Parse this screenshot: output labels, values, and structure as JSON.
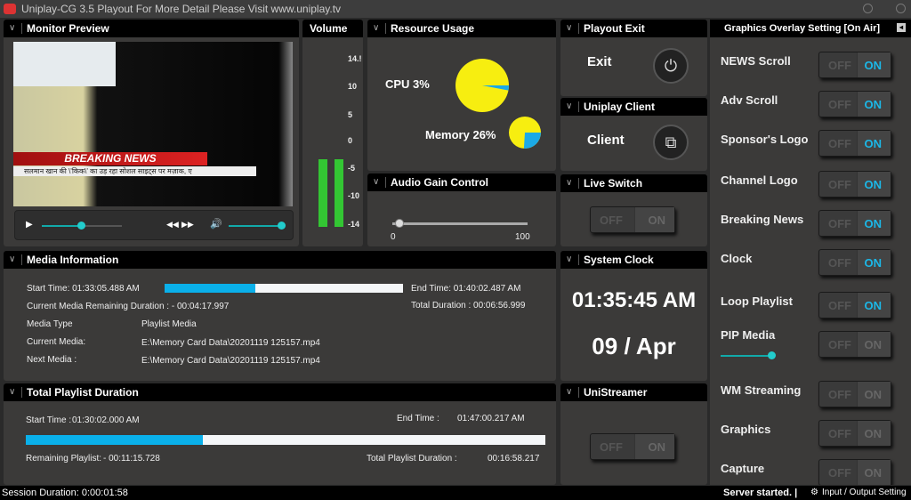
{
  "title": "Uniplay-CG 3.5 Playout For More Detail Please Visit www.uniplay.tv",
  "monitor": {
    "title": "Monitor Preview",
    "breaking": "BREAKING NEWS",
    "ticker": "सलमान खान की \\'किक\\' का उड़ रहा सोशल साइट्स पर मज़ाक, ए",
    "seek_progress": 0.49,
    "volume_level": 1.0,
    "icons": [
      "play-icon",
      "rewind-icon",
      "fast-forward-icon",
      "speaker-icon"
    ]
  },
  "volume": {
    "title": "Volume",
    "ticks": [
      "14.!",
      "10",
      "5",
      "0",
      "-5",
      "-10",
      "-14"
    ],
    "left_level": 0.35,
    "right_level": 0.35
  },
  "resource": {
    "title": "Resource Usage",
    "cpu": "CPU 3%",
    "memory": "Memory 26%",
    "cpu_pct": 3,
    "memory_pct": 26,
    "color_main": "#f7ee10",
    "color_used": "#1ba9e6"
  },
  "audio": {
    "title": "Audio Gain Control",
    "min": "0",
    "max": "100",
    "value": 5
  },
  "playout": {
    "title": "Playout Exit",
    "label": "Exit"
  },
  "client": {
    "title": "Uniplay Client",
    "label": "Client"
  },
  "live": {
    "title": "Live Switch",
    "off": "OFF",
    "on": "ON"
  },
  "media": {
    "title": "Media Information",
    "start": "Start Time:  01:33:05.488 AM",
    "end": "End Time:  01:40:02.487 AM",
    "remaining": "Current Media Remaining Duration : - 00:04:17.997",
    "total": "Total Duration :  00:06:56.999",
    "progress": 0.38,
    "rows": [
      {
        "k": "Media Type",
        "v": "Playlist Media"
      },
      {
        "k": "Current Media:",
        "v": "E:\\Memory Card Data\\20201119 125157.mp4"
      },
      {
        "k": "Next Media :",
        "v": "E:\\Memory Card Data\\20201119 125157.mp4"
      }
    ]
  },
  "clock": {
    "title": "System Clock",
    "time": "01:35:45 AM",
    "date": "09 / Apr"
  },
  "playlist": {
    "title": "Total Playlist Duration",
    "start_k": "Start Time :",
    "start_v": "01:30:02.000 AM",
    "end_k": "End Time :",
    "end_v": "01:47:00.217 AM",
    "progress": 0.34,
    "remaining_k": "Remaining Playlist:",
    "remaining_v": "- 00:11:15.728",
    "total_k": "Total Playlist Duration :",
    "total_v": "00:16:58.217"
  },
  "streamer": {
    "title": "UniStreamer",
    "off": "OFF",
    "on": "ON"
  },
  "overlay": {
    "title": "Graphics Overlay Setting [On Air]",
    "off": "OFF",
    "on": "ON",
    "pip_level": 1.0,
    "items": [
      {
        "label": "NEWS Scroll",
        "on": true
      },
      {
        "label": "Adv Scroll",
        "on": true
      },
      {
        "label": "Sponsor's Logo",
        "on": true
      },
      {
        "label": "Channel Logo",
        "on": true
      },
      {
        "label": "Breaking News",
        "on": true
      },
      {
        "label": "Clock",
        "on": true
      },
      {
        "label": "Loop Playlist",
        "on": true
      },
      {
        "label": "PIP Media",
        "on": false
      },
      {
        "label": "WM Streaming",
        "on": false
      },
      {
        "label": "Graphics",
        "on": false
      },
      {
        "label": "Capture",
        "on": false
      }
    ]
  },
  "status": {
    "session": "Session Duration: 0:00:01:58",
    "server": "Server started. |",
    "io": "Input / Output Setting"
  }
}
